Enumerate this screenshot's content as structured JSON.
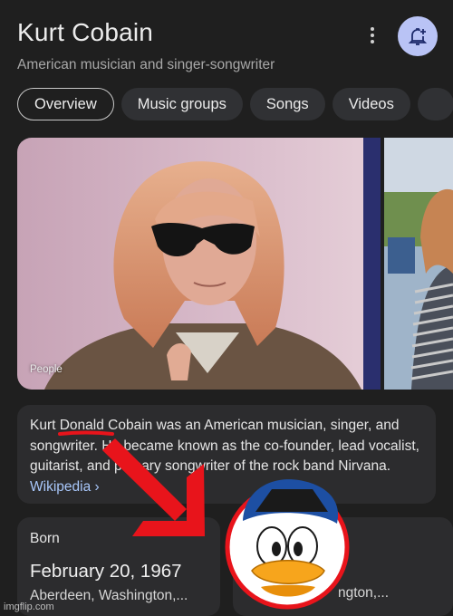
{
  "header": {
    "title": "Kurt Cobain",
    "subtitle": "American musician and singer-songwriter",
    "more_icon": "more-vert-icon",
    "follow_icon": "bell-plus-icon"
  },
  "tabs": [
    {
      "label": "Overview",
      "active": true
    },
    {
      "label": "Music groups",
      "active": false
    },
    {
      "label": "Songs",
      "active": false
    },
    {
      "label": "Videos",
      "active": false
    },
    {
      "label": "",
      "active": false
    }
  ],
  "photo": {
    "caption": "People"
  },
  "description": {
    "part1": "Kurt ",
    "part2": "Donald",
    "part3": " Cobain was an American musician, singer, and songwriter. He became known as the co-founder, lead vocalist, guitarist, and primary songwriter of the rock band Nirvana. ",
    "link": "Wikipedia ›"
  },
  "born": {
    "label": "Born",
    "date": "February 20, 1967",
    "place": "Aberdeen, Washington,..."
  },
  "second_card": {
    "place": "ngton,..."
  },
  "annotation": {
    "underline_color": "#e8141b",
    "arrow_color": "#e8141b",
    "circle_border_color": "#e8141b"
  },
  "watermark": "imgflip.com",
  "colors": {
    "background": "#1f1f1f",
    "card": "#2c2c2e",
    "link": "#a8c7fa",
    "follow_button": "#b9c3f5"
  }
}
